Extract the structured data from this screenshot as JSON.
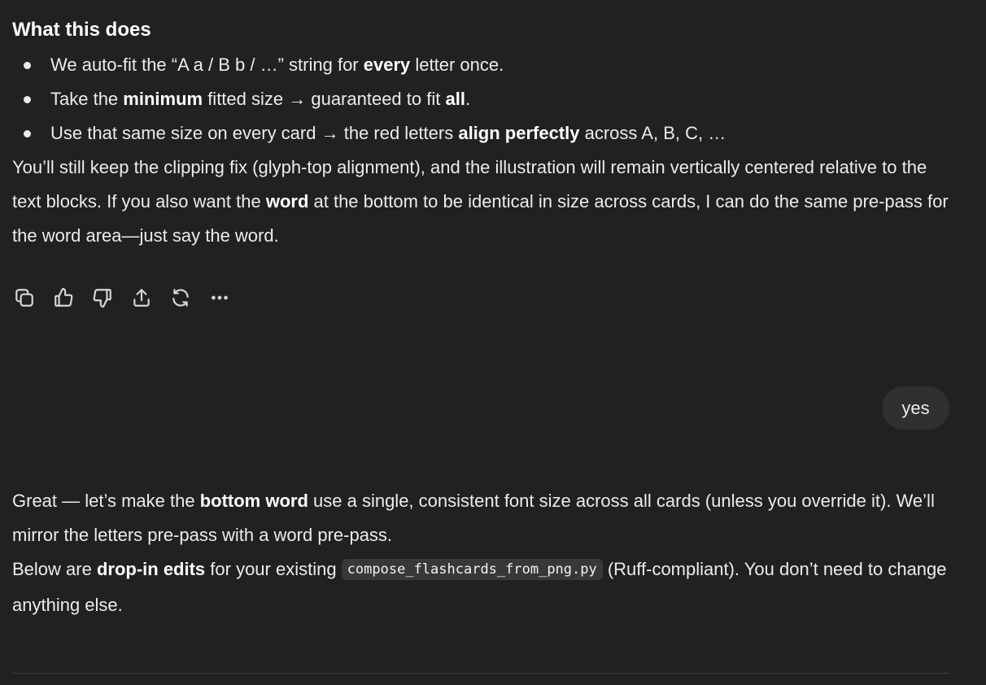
{
  "assistant_message_1": {
    "heading": "What this does",
    "bullets": [
      {
        "a": "We auto-fit the “A a / B b / …” string for ",
        "b1": "every",
        "c": " letter once."
      },
      {
        "a": "Take the ",
        "b1": "minimum",
        "c": " fitted size → guaranteed to fit ",
        "b2": "all",
        "d": "."
      },
      {
        "a": "Use that same size on every card → the red letters ",
        "b1": "align perfectly",
        "c": " across A, B, C, …"
      }
    ],
    "paragraph": {
      "a": "You’ll still keep the clipping fix (glyph-top alignment), and the illustration will remain vertically centered relative to the text blocks. If you also want the ",
      "b": "word",
      "c": " at the bottom to be identical in size across cards, I can do the same pre-pass for the word area—just say the word."
    }
  },
  "actions": [
    {
      "name": "copy-icon"
    },
    {
      "name": "thumbs-up-icon"
    },
    {
      "name": "thumbs-down-icon"
    },
    {
      "name": "share-icon"
    },
    {
      "name": "regenerate-icon"
    },
    {
      "name": "more-icon"
    }
  ],
  "user_message": {
    "text": "yes"
  },
  "assistant_message_2": {
    "para1": {
      "a": "Great — let’s make the ",
      "b": "bottom word",
      "c": " use a single, consistent font size across all cards (unless you override it). We’ll mirror the letters pre-pass with a word pre-pass."
    },
    "para2": {
      "a": "Below are ",
      "b": "drop-in edits",
      "c": " for your existing ",
      "code": "compose_flashcards_from_png.py",
      "d": " (Ruff-compliant). You don’t need to change anything else."
    }
  },
  "colors": {
    "background": "#212121",
    "text": "#ececec",
    "user_bubble": "#303030",
    "code_bg": "#383838"
  }
}
